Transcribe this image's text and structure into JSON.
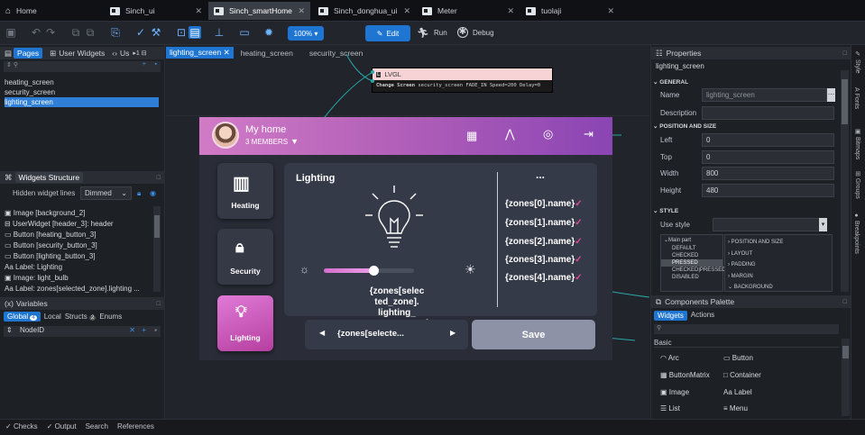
{
  "tabs": [
    {
      "label": "Home"
    },
    {
      "label": "Sinch_ui"
    },
    {
      "label": "Sinch_smartHome"
    },
    {
      "label": "Sinch_donghua_ui"
    },
    {
      "label": "Meter"
    },
    {
      "label": "tuolaji"
    }
  ],
  "toolbar": {
    "zoom": "100%",
    "edit": "Edit",
    "run": "Run",
    "debug": "Debug"
  },
  "left": {
    "pages_tab": "Pages",
    "user_widgets_tab": "User Widgets",
    "us_tab": "Us",
    "pages": [
      "heating_screen",
      "security_screen",
      "lighting_screen"
    ],
    "widgets_title": "Widgets Structure",
    "hidden_label": "Hidden widget lines",
    "hidden_value": "Dimmed",
    "widgets": [
      "Image [background_2]",
      "UserWidget [header_3]: header",
      "Button [heating_button_3]",
      "Button [security_button_3]",
      "Button [lighting_button_3]",
      "Label: Lighting",
      "Image: light_bulb",
      "Label: zones[selected_zone].lighting ..."
    ],
    "variables_title": "Variables",
    "var_tabs": [
      "Global",
      "Local",
      "Structs",
      "Enums"
    ],
    "var_counts": {
      "global": "4",
      "structs": "2"
    },
    "var_item": "NodeID"
  },
  "editor_tabs": [
    "lighting_screen",
    "heating_screen",
    "security_screen"
  ],
  "lvgl": {
    "title": "LVGL",
    "action": "Change Screen",
    "code": "security_screen FADE_IN Speed=200 Delay=0"
  },
  "screen": {
    "title": "My home",
    "members": "3 MEMBERS",
    "buttons": [
      "Heating",
      "Security",
      "Lighting"
    ],
    "section": "Lighting",
    "dots": "...",
    "zones": [
      "{zones[0].name}",
      "{zones[1].name}",
      "{zones[2].name}",
      "{zones[3].name}",
      "{zones[4].name}"
    ],
    "percent_text": "{zones[selec ted_zone]. lighting_ percent + \" %\"}",
    "selector": "{zones[selecte...",
    "save": "Save",
    "slider_value": 0.55
  },
  "properties": {
    "title": "Properties",
    "screen_name": "lighting_screen",
    "general": "GENERAL",
    "name_label": "Name",
    "name_value": "lighting_screen",
    "desc_label": "Description",
    "pos": "POSITION AND SIZE",
    "left_label": "Left",
    "left": "0",
    "top_label": "Top",
    "top": "0",
    "width_label": "Width",
    "width": "800",
    "height_label": "Height",
    "height": "480",
    "style": "STYLE",
    "use_style": "Use style",
    "parts": [
      "Main part",
      "DEFAULT",
      "CHECKED",
      "PRESSED",
      "CHECKED|PRESSED",
      "DISABLED"
    ],
    "style_groups": [
      "POSITION AND SIZE",
      "LAYOUT",
      "PADDING",
      "MARGIN",
      "BACKGROUND"
    ]
  },
  "palette": {
    "title": "Components Palette",
    "tabs": [
      "Widgets",
      "Actions"
    ],
    "basic": "Basic",
    "items": [
      "Arc",
      "Button",
      "ButtonMatrix",
      "Container",
      "Image",
      "Label",
      "List",
      "Menu"
    ]
  },
  "right_sidebar": [
    "Style",
    "Fonts",
    "Bitmaps",
    "Groups",
    "Breakpoints"
  ],
  "status": [
    "Checks",
    "Output",
    "Search",
    "References"
  ]
}
